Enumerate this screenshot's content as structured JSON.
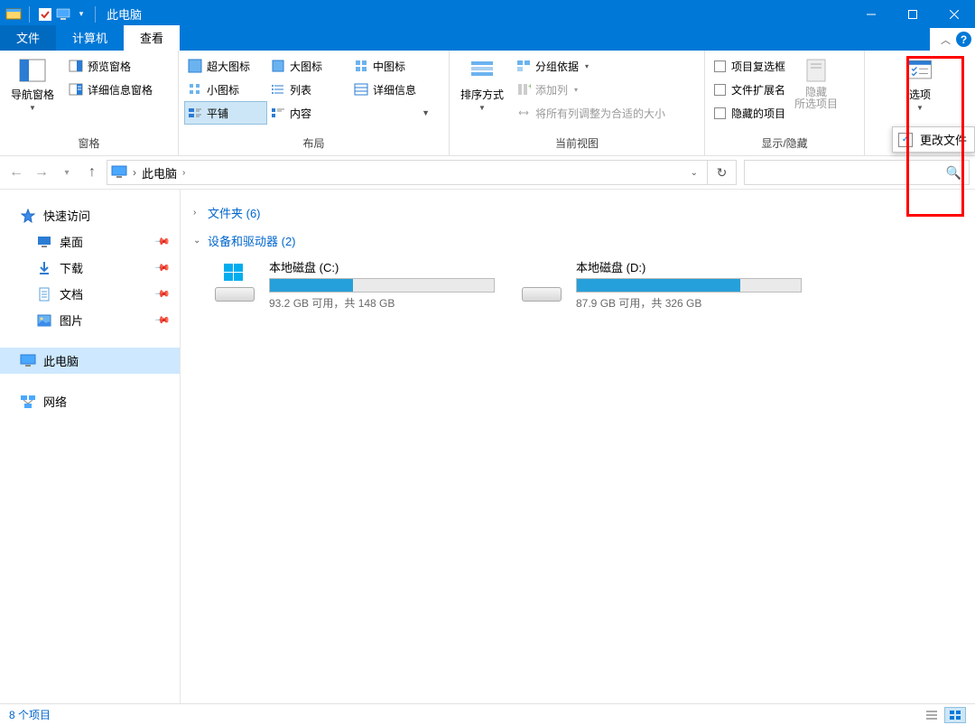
{
  "window": {
    "title": "此电脑"
  },
  "tabs": {
    "file": "文件",
    "computer": "计算机",
    "view": "查看"
  },
  "ribbon": {
    "panes": {
      "label": "窗格",
      "nav_pane": "导航窗格",
      "preview_pane": "预览窗格",
      "details_pane": "详细信息窗格"
    },
    "layout": {
      "label": "布局",
      "extra_large": "超大图标",
      "large": "大图标",
      "medium": "中图标",
      "small": "小图标",
      "list": "列表",
      "details": "详细信息",
      "tiles": "平铺",
      "content": "内容"
    },
    "current_view": {
      "label": "当前视图",
      "sort_by": "排序方式",
      "group_by": "分组依据",
      "add_columns": "添加列",
      "size_all": "将所有列调整为合适的大小"
    },
    "show_hide": {
      "label": "显示/隐藏",
      "item_check": "项目复选框",
      "file_ext": "文件扩展名",
      "hidden_items": "隐藏的项目",
      "hide_selected": "隐藏\n所选项目"
    },
    "options": {
      "label": "选项",
      "change_opts": "更改文件"
    }
  },
  "address": {
    "location": "此电脑"
  },
  "search": {
    "placeholder": ""
  },
  "nav": {
    "quick_access": "快速访问",
    "desktop": "桌面",
    "downloads": "下载",
    "documents": "文档",
    "pictures": "图片",
    "this_pc": "此电脑",
    "network": "网络"
  },
  "groups": {
    "folders": "文件夹 (6)",
    "devices": "设备和驱动器 (2)"
  },
  "drives": [
    {
      "name": "本地磁盘 (C:)",
      "free": "93.2 GB 可用，共 148 GB",
      "fill_pct": 37,
      "windows": true
    },
    {
      "name": "本地磁盘 (D:)",
      "free": "87.9 GB 可用，共 326 GB",
      "fill_pct": 73,
      "windows": false
    }
  ],
  "status": {
    "items": "8 个项目"
  }
}
